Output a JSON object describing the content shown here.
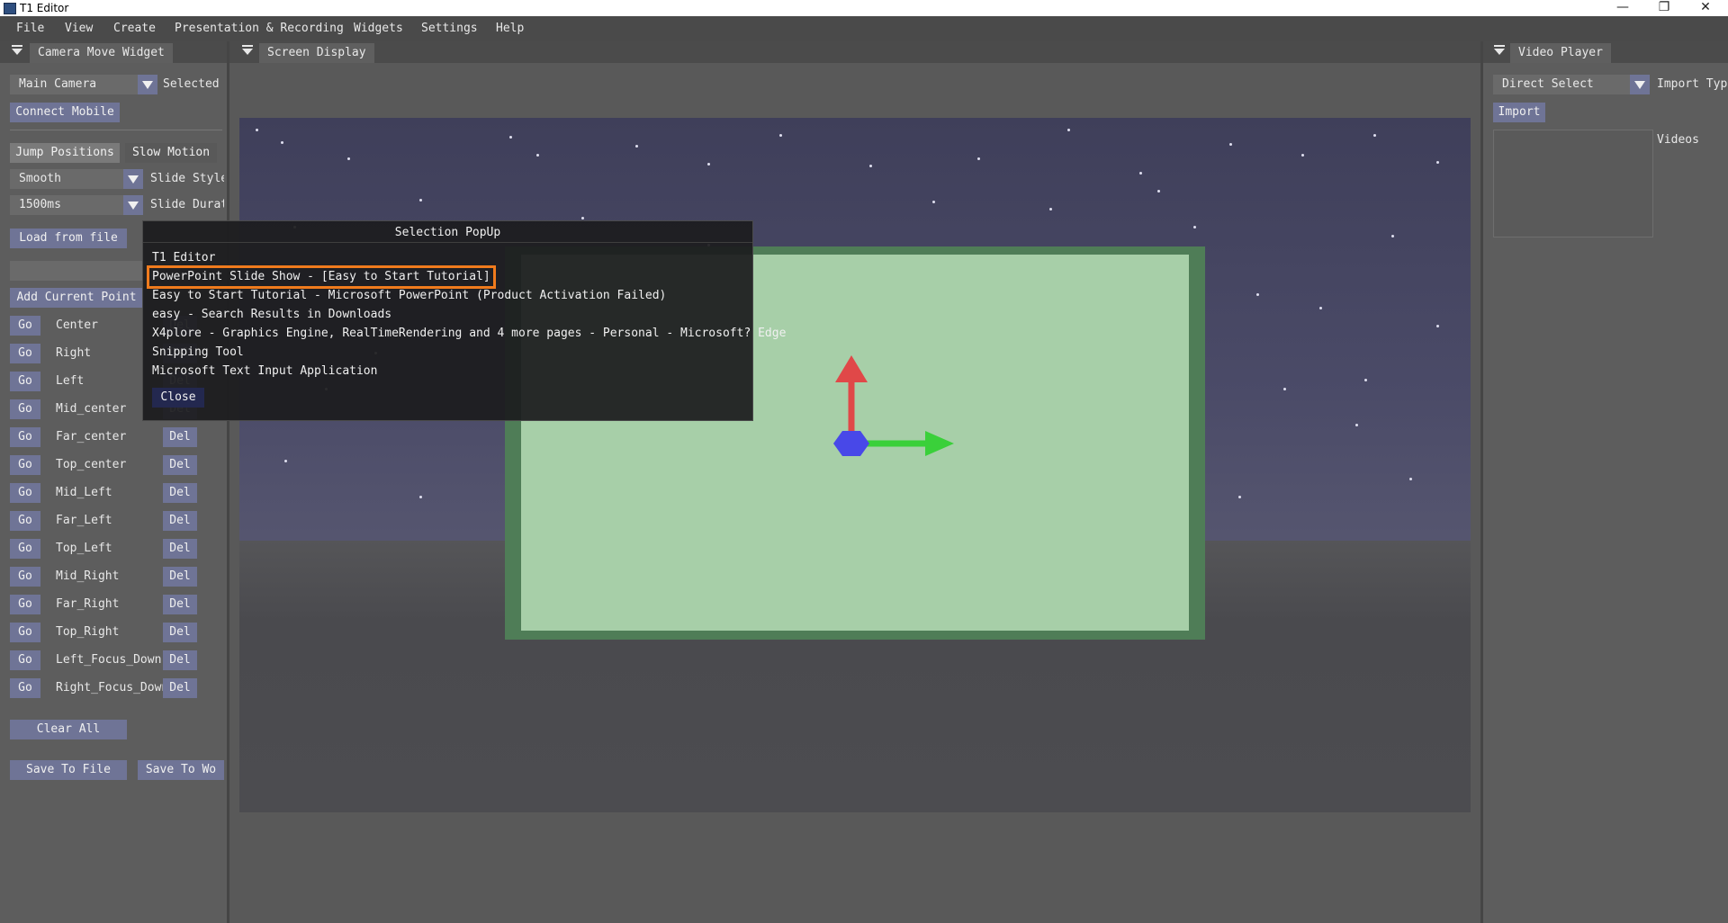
{
  "window": {
    "title": "T1 Editor",
    "minimize": "—",
    "restore": "❐",
    "close": "✕"
  },
  "menu": [
    "File",
    "View",
    "Create",
    "Presentation & Recording",
    "Widgets",
    "Settings",
    "Help"
  ],
  "left_panel": {
    "tab": "Camera Move Widget",
    "camera_combo": "Main Camera",
    "selected_label": "Selected",
    "connect_mobile": "Connect Mobile",
    "mode_tabs": [
      "Jump Positions",
      "Slow Motion"
    ],
    "style_combo": "Smooth",
    "style_label": "Slide Style",
    "duration_combo": "1500ms",
    "duration_label": "Slide Duration",
    "load_from_file": "Load from file",
    "point_name_value": "",
    "add_current_point": "Add Current Point",
    "go_label": "Go",
    "del_label": "Del",
    "points": [
      "Center",
      "Right",
      "Left",
      "Mid_center",
      "Far_center",
      "Top_center",
      "Mid_Left",
      "Far_Left",
      "Top_Left",
      "Mid_Right",
      "Far_Right",
      "Top_Right",
      "Left_Focus_Down",
      "Right_Focus_Down"
    ],
    "clear_all": "Clear All",
    "save_to_file": "Save To File",
    "save_to_wo": "Save To Wo"
  },
  "center_panel": {
    "tab": "Screen Display"
  },
  "right_panel": {
    "tab": "Video Player",
    "select_combo": "Direct Select",
    "import_type_label": "Import Typ",
    "import_button": "Import",
    "videos_label": "Videos"
  },
  "popup": {
    "title": "Selection PopUp",
    "items": [
      "T1 Editor",
      "PowerPoint Slide Show - [Easy to Start Tutorial]",
      "Easy to Start Tutorial - Microsoft PowerPoint (Product Activation Failed)",
      "easy - Search Results in Downloads",
      "X4plore - Graphics Engine, RealTimeRendering and 4 more pages - Personal - Microsoft? Edge",
      "Snipping Tool",
      "Microsoft Text Input Application"
    ],
    "selected_index": 1,
    "close_button": "Close"
  },
  "colors": {
    "accent_button": "#6f7496",
    "selection_outline": "#f07b1d",
    "gizmo_y": "#e04848",
    "gizmo_x": "#3ad03a",
    "gizmo_center": "#4848e8"
  }
}
